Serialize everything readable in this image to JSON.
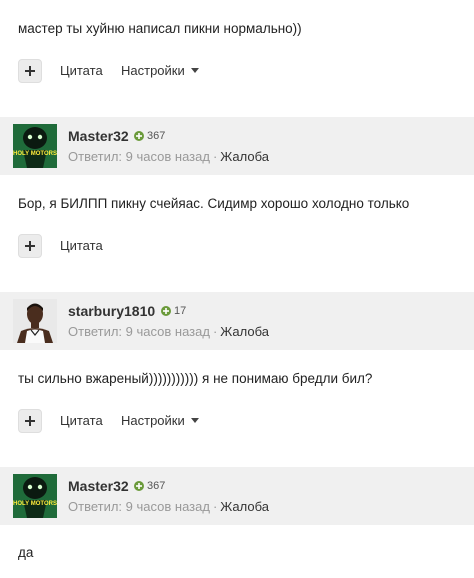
{
  "posts": [
    {
      "text": "мастер ты хуйню написал пикни нормально))",
      "actions": {
        "quote": "Цитата",
        "settings": "Настройки"
      }
    },
    {
      "author": "Master32",
      "reputation": "367",
      "meta": "Ответил: 9 часов назад",
      "complaint": "Жалоба",
      "avatar_text": "HOLY MOTORS",
      "text": "Бор, я БИЛПП пикну счейяас. Сидимр хорошо холодно только",
      "actions": {
        "quote": "Цитата"
      }
    },
    {
      "author": "starbury1810",
      "reputation": "17",
      "meta": "Ответил: 9 часов назад",
      "complaint": "Жалоба",
      "text": "ты сильно вжареный))))))))))) я не понимаю бредли бил?",
      "actions": {
        "quote": "Цитата",
        "settings": "Настройки"
      }
    },
    {
      "author": "Master32",
      "reputation": "367",
      "meta": "Ответил: 9 часов назад",
      "complaint": "Жалоба",
      "avatar_text": "HOLY MOTORS",
      "text": "да"
    }
  ],
  "colors": {
    "header_bg": "#f0f0f0",
    "rep_icon": "#6a9a3a",
    "avatar_green": "#1f6b3a"
  },
  "icons": {
    "plus": "plus-icon",
    "rep": "reputation-plus-icon",
    "caret": "chevron-down-icon"
  }
}
